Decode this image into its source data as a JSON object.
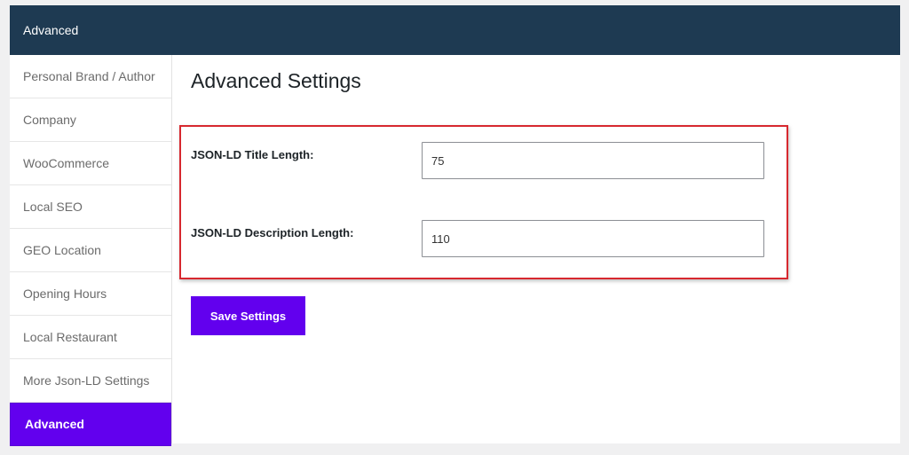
{
  "header": {
    "title": "Advanced"
  },
  "sidebar": {
    "items": [
      {
        "label": "Personal Brand / Author",
        "active": false
      },
      {
        "label": "Company",
        "active": false
      },
      {
        "label": "WooCommerce",
        "active": false
      },
      {
        "label": "Local SEO",
        "active": false
      },
      {
        "label": "GEO Location",
        "active": false
      },
      {
        "label": "Opening Hours",
        "active": false
      },
      {
        "label": "Local Restaurant",
        "active": false
      },
      {
        "label": "More Json-LD Settings",
        "active": false
      },
      {
        "label": "Advanced",
        "active": true
      }
    ]
  },
  "main": {
    "title": "Advanced Settings",
    "fields": [
      {
        "label": "JSON-LD Title Length:",
        "value": "75"
      },
      {
        "label": "JSON-LD Description Length:",
        "value": "110"
      }
    ],
    "save_label": "Save Settings"
  },
  "colors": {
    "header_bg": "#1e3a52",
    "accent": "#6200ee",
    "highlight_border": "#d7282f"
  }
}
